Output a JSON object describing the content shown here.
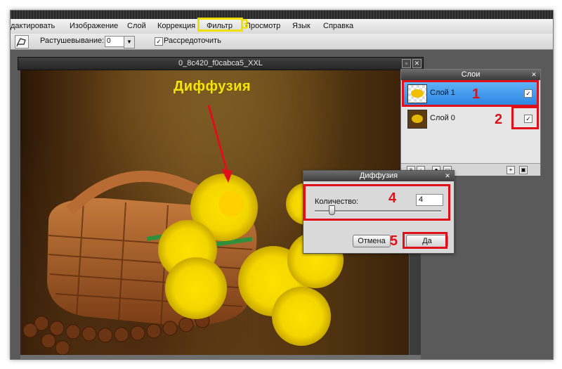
{
  "menu": {
    "items": [
      "дактировать",
      "Изображение",
      "Слой",
      "Коррекция",
      "Фильтр",
      "Просмотр",
      "Язык",
      "Справка"
    ]
  },
  "toolbar": {
    "feather_label": "Растушевывание:",
    "feather_value": "0",
    "refine_label": "Рассредоточить"
  },
  "document": {
    "title": "0_8c420_f0cabca5_XXL"
  },
  "annotation": {
    "filter_title": "Диффузия",
    "steps": [
      "1",
      "2",
      "3",
      "4",
      "5"
    ]
  },
  "layers_panel": {
    "title": "Слои",
    "layers": [
      {
        "name": "Слой 1",
        "selected": true,
        "visible": true
      },
      {
        "name": "Слой 0",
        "selected": false,
        "visible": true
      }
    ]
  },
  "dialog": {
    "title": "Диффузия",
    "amount_label": "Количество:",
    "amount_value": "4",
    "cancel_label": "Отмена",
    "ok_label": "Да"
  },
  "colors": {
    "annotation_red": "#e0101a",
    "annotation_yellow": "#f0e000",
    "selection_blue": "#2d87e3",
    "ui_dark": "#2b2b2b"
  }
}
